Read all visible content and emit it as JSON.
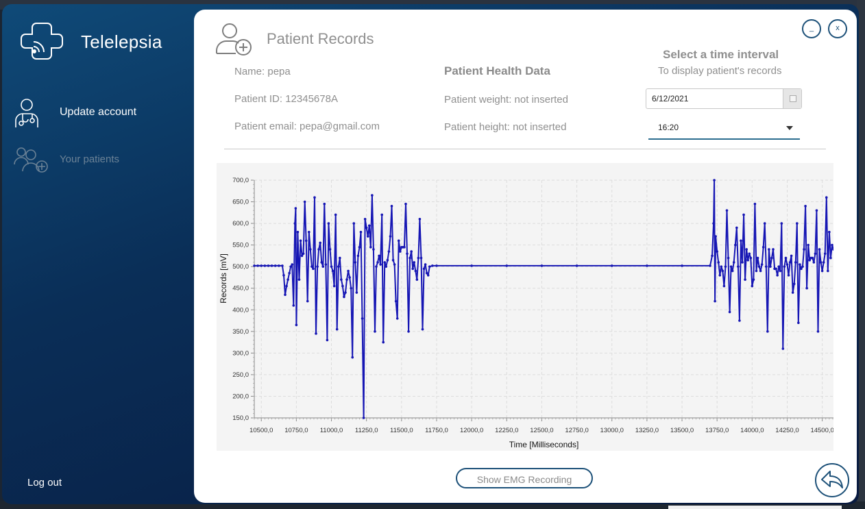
{
  "app": {
    "title": "Telelepsia"
  },
  "sidebar": {
    "items": [
      {
        "label": "Update account",
        "icon": "doctor-icon"
      },
      {
        "label": "Your patients",
        "icon": "add-patients-icon"
      }
    ],
    "logout_label": "Log out"
  },
  "header": {
    "title": "Patient Records",
    "icon": "add-user-icon"
  },
  "window_controls": {
    "minimize_label": "_",
    "close_label": "x"
  },
  "patient": {
    "name": "Name: pepa",
    "id": "Patient ID: 12345678A",
    "email": "Patient email: pepa@gmail.com"
  },
  "health": {
    "title": "Patient Health Data",
    "weight": "Patient weight: not inserted",
    "height": "Patient height: not inserted"
  },
  "time_interval": {
    "title": "Select a time interval",
    "subtitle": "To display patient's records",
    "date_value": "6/12/2021",
    "time_value": "16:20"
  },
  "buttons": {
    "show_emg": "Show EMG Recording"
  },
  "colors": {
    "series": "#1616b4",
    "accent": "#1c5078"
  },
  "chart_data": {
    "type": "line",
    "xlabel": "Time [Milliseconds]",
    "ylabel": "Records [mV]",
    "xlim": [
      10450,
      14580
    ],
    "ylim": [
      150,
      700
    ],
    "grid": true,
    "legend": "none",
    "x_ticks": [
      10500,
      10750,
      11000,
      11250,
      11500,
      11750,
      12000,
      12250,
      12500,
      12750,
      13000,
      13250,
      13500,
      13750,
      14000,
      14250,
      14500
    ],
    "x_tick_labels": [
      "10500,0",
      "10750,0",
      "11000,0",
      "11250,0",
      "11500,0",
      "11750,0",
      "12000,0",
      "12250,0",
      "12500,0",
      "12750,0",
      "13000,0",
      "13250,0",
      "13500,0",
      "13750,0",
      "14000,0",
      "14250,0",
      "14500,0"
    ],
    "y_ticks": [
      150,
      200,
      250,
      300,
      350,
      400,
      450,
      500,
      550,
      600,
      650,
      700
    ],
    "y_tick_labels": [
      "150,0",
      "200,0",
      "250,0",
      "300,0",
      "350,0",
      "400,0",
      "450,0",
      "500,0",
      "550,0",
      "600,0",
      "650,0",
      "700,0"
    ],
    "series": [
      {
        "values": [
          [
            10450,
            502
          ],
          [
            10475,
            502
          ],
          [
            10500,
            502
          ],
          [
            10525,
            502
          ],
          [
            10550,
            502
          ],
          [
            10575,
            502
          ],
          [
            10600,
            502
          ],
          [
            10625,
            502
          ],
          [
            10650,
            502
          ],
          [
            10660,
            480
          ],
          [
            10670,
            435
          ],
          [
            10680,
            455
          ],
          [
            10690,
            470
          ],
          [
            10700,
            485
          ],
          [
            10710,
            500
          ],
          [
            10720,
            505
          ],
          [
            10730,
            410
          ],
          [
            10740,
            600
          ],
          [
            10745,
            635
          ],
          [
            10750,
            365
          ],
          [
            10760,
            580
          ],
          [
            10770,
            470
          ],
          [
            10780,
            560
          ],
          [
            10790,
            525
          ],
          [
            10800,
            530
          ],
          [
            10810,
            650
          ],
          [
            10820,
            560
          ],
          [
            10830,
            420
          ],
          [
            10840,
            580
          ],
          [
            10850,
            540
          ],
          [
            10860,
            500
          ],
          [
            10870,
            495
          ],
          [
            10880,
            660
          ],
          [
            10890,
            345
          ],
          [
            10900,
            500
          ],
          [
            10910,
            540
          ],
          [
            10920,
            555
          ],
          [
            10930,
            510
          ],
          [
            10940,
            500
          ],
          [
            10950,
            645
          ],
          [
            10960,
            505
          ],
          [
            10970,
            330
          ],
          [
            10980,
            600
          ],
          [
            10990,
            540
          ],
          [
            11000,
            500
          ],
          [
            11010,
            490
          ],
          [
            11020,
            455
          ],
          [
            11030,
            620
          ],
          [
            11040,
            355
          ],
          [
            11050,
            500
          ],
          [
            11060,
            520
          ],
          [
            11070,
            470
          ],
          [
            11080,
            455
          ],
          [
            11090,
            430
          ],
          [
            11100,
            440
          ],
          [
            11110,
            470
          ],
          [
            11120,
            490
          ],
          [
            11130,
            475
          ],
          [
            11140,
            450
          ],
          [
            11150,
            290
          ],
          [
            11160,
            600
          ],
          [
            11170,
            510
          ],
          [
            11180,
            440
          ],
          [
            11190,
            525
          ],
          [
            11200,
            545
          ],
          [
            11210,
            580
          ],
          [
            11220,
            380
          ],
          [
            11230,
            150
          ],
          [
            11240,
            610
          ],
          [
            11250,
            590
          ],
          [
            11260,
            570
          ],
          [
            11270,
            595
          ],
          [
            11280,
            545
          ],
          [
            11290,
            665
          ],
          [
            11300,
            540
          ],
          [
            11310,
            350
          ],
          [
            11320,
            500
          ],
          [
            11330,
            510
          ],
          [
            11340,
            525
          ],
          [
            11350,
            505
          ],
          [
            11360,
            620
          ],
          [
            11370,
            325
          ],
          [
            11380,
            510
          ],
          [
            11390,
            500
          ],
          [
            11400,
            515
          ],
          [
            11410,
            535
          ],
          [
            11420,
            570
          ],
          [
            11430,
            640
          ],
          [
            11440,
            515
          ],
          [
            11450,
            505
          ],
          [
            11460,
            420
          ],
          [
            11470,
            380
          ],
          [
            11480,
            560
          ],
          [
            11490,
            535
          ],
          [
            11500,
            545
          ],
          [
            11510,
            545
          ],
          [
            11520,
            545
          ],
          [
            11530,
            645
          ],
          [
            11540,
            530
          ],
          [
            11550,
            350
          ],
          [
            11560,
            520
          ],
          [
            11570,
            535
          ],
          [
            11580,
            495
          ],
          [
            11590,
            510
          ],
          [
            11600,
            490
          ],
          [
            11610,
            470
          ],
          [
            11620,
            520
          ],
          [
            11630,
            610
          ],
          [
            11640,
            520
          ],
          [
            11650,
            355
          ],
          [
            11660,
            495
          ],
          [
            11670,
            505
          ],
          [
            11680,
            485
          ],
          [
            11690,
            480
          ],
          [
            11700,
            500
          ],
          [
            11720,
            502
          ],
          [
            11750,
            502
          ],
          [
            12000,
            502
          ],
          [
            12250,
            502
          ],
          [
            12500,
            502
          ],
          [
            12750,
            502
          ],
          [
            13000,
            502
          ],
          [
            13250,
            502
          ],
          [
            13500,
            502
          ],
          [
            13700,
            502
          ],
          [
            13715,
            525
          ],
          [
            13725,
            600
          ],
          [
            13730,
            700
          ],
          [
            13735,
            420
          ],
          [
            13740,
            570
          ],
          [
            13750,
            535
          ],
          [
            13760,
            510
          ],
          [
            13770,
            480
          ],
          [
            13780,
            500
          ],
          [
            13790,
            490
          ],
          [
            13800,
            455
          ],
          [
            13810,
            500
          ],
          [
            13820,
            630
          ],
          [
            13830,
            520
          ],
          [
            13840,
            395
          ],
          [
            13850,
            500
          ],
          [
            13860,
            490
          ],
          [
            13870,
            510
          ],
          [
            13880,
            550
          ],
          [
            13890,
            590
          ],
          [
            13900,
            500
          ],
          [
            13910,
            375
          ],
          [
            13920,
            560
          ],
          [
            13930,
            510
          ],
          [
            13940,
            620
          ],
          [
            13950,
            470
          ],
          [
            13960,
            540
          ],
          [
            13970,
            515
          ],
          [
            13980,
            530
          ],
          [
            13990,
            520
          ],
          [
            14000,
            455
          ],
          [
            14010,
            470
          ],
          [
            14020,
            645
          ],
          [
            14030,
            490
          ],
          [
            14040,
            520
          ],
          [
            14050,
            500
          ],
          [
            14060,
            490
          ],
          [
            14070,
            505
          ],
          [
            14080,
            545
          ],
          [
            14090,
            600
          ],
          [
            14100,
            500
          ],
          [
            14110,
            350
          ],
          [
            14120,
            540
          ],
          [
            14130,
            500
          ],
          [
            14140,
            520
          ],
          [
            14150,
            540
          ],
          [
            14160,
            495
          ],
          [
            14170,
            495
          ],
          [
            14180,
            480
          ],
          [
            14190,
            500
          ],
          [
            14200,
            490
          ],
          [
            14210,
            600
          ],
          [
            14220,
            310
          ],
          [
            14230,
            500
          ],
          [
            14240,
            520
          ],
          [
            14250,
            505
          ],
          [
            14260,
            480
          ],
          [
            14270,
            510
          ],
          [
            14280,
            525
          ],
          [
            14290,
            440
          ],
          [
            14300,
            460
          ],
          [
            14310,
            510
          ],
          [
            14320,
            600
          ],
          [
            14330,
            370
          ],
          [
            14340,
            505
          ],
          [
            14350,
            495
          ],
          [
            14360,
            500
          ],
          [
            14370,
            540
          ],
          [
            14380,
            640
          ],
          [
            14390,
            450
          ],
          [
            14400,
            550
          ],
          [
            14410,
            515
          ],
          [
            14420,
            520
          ],
          [
            14430,
            520
          ],
          [
            14440,
            510
          ],
          [
            14450,
            530
          ],
          [
            14460,
            630
          ],
          [
            14470,
            350
          ],
          [
            14480,
            540
          ],
          [
            14490,
            510
          ],
          [
            14500,
            490
          ],
          [
            14510,
            510
          ],
          [
            14520,
            530
          ],
          [
            14530,
            660
          ],
          [
            14540,
            490
          ],
          [
            14550,
            580
          ],
          [
            14560,
            520
          ],
          [
            14570,
            550
          ],
          [
            14580,
            540
          ]
        ]
      }
    ]
  }
}
